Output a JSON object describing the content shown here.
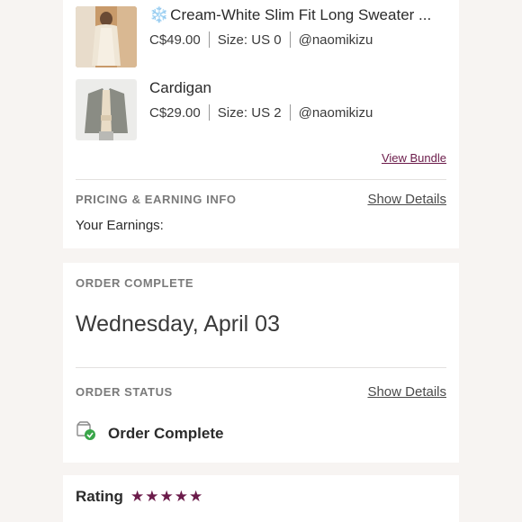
{
  "order": {
    "items": [
      {
        "emoji": "❄️",
        "title": "Cream-White Slim Fit Long Sweater ...",
        "price": "C$49.00",
        "size": "Size: US 0",
        "seller": "@naomikizu"
      },
      {
        "emoji": "",
        "title": "Cardigan",
        "price": "C$29.00",
        "size": "Size: US 2",
        "seller": "@naomikizu"
      }
    ],
    "view_bundle": "View Bundle"
  },
  "pricing": {
    "label": "PRICING & EARNING INFO",
    "show_details": "Show Details",
    "earnings_label": "Your Earnings:"
  },
  "order_complete": {
    "label": "ORDER COMPLETE",
    "date": "Wednesday, April 03"
  },
  "order_status": {
    "label": "ORDER STATUS",
    "show_details": "Show Details",
    "status": "Order Complete"
  },
  "rating": {
    "label": "Rating",
    "stars": "★★★★★",
    "value": 5,
    "max": 5
  },
  "colors": {
    "accent": "#6b1b4a",
    "check": "#3aa64a"
  }
}
